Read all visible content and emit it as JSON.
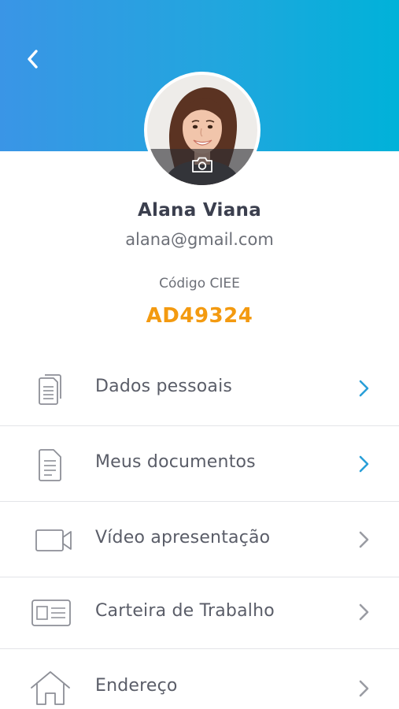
{
  "header": {
    "back_icon": "chevron-left-icon",
    "gradient": [
      "#3a95e6",
      "#00b2d9"
    ]
  },
  "profile": {
    "name": "Alana Viana",
    "email": "alana@gmail.com",
    "code_label": "Código CIEE",
    "code_value": "AD49324",
    "code_color": "#f39a10",
    "camera_icon": "camera-icon"
  },
  "menu": {
    "items": [
      {
        "label": "Dados pessoais",
        "icon": "documents-stack-icon",
        "chevron_color": "#2a9fd8"
      },
      {
        "label": "Meus documentos",
        "icon": "document-icon",
        "chevron_color": "#2a9fd8"
      },
      {
        "label": "Vídeo apresentação",
        "icon": "video-camera-icon",
        "chevron_color": "#9a9ca3"
      },
      {
        "label": "Carteira de Trabalho",
        "icon": "id-card-icon",
        "chevron_color": "#9a9ca3"
      },
      {
        "label": "Endereço",
        "icon": "home-icon",
        "chevron_color": "#9a9ca3"
      }
    ]
  }
}
